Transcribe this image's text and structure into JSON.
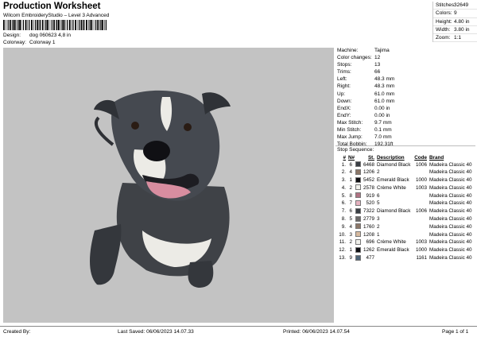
{
  "header": {
    "title": "Production Worksheet",
    "subtitle": "Wilcom EmbroideryStudio – Level 3 Advanced",
    "design_label": "Design:",
    "design_value": "dog 060623 4,8 in",
    "colorway_label": "Colorway:",
    "colorway_value": "Colorway 1"
  },
  "summary": [
    {
      "label": "Stitches:",
      "value": "32649"
    },
    {
      "label": "Colors:",
      "value": "9"
    },
    {
      "label": "Height:",
      "value": "4.80 in"
    },
    {
      "label": "Width:",
      "value": "3.80 in"
    },
    {
      "label": "Zoom:",
      "value": "1:1"
    }
  ],
  "specs": [
    {
      "label": "Machine:",
      "value": "Tajima"
    },
    {
      "label": "Color changes:",
      "value": "12"
    },
    {
      "label": "Stops:",
      "value": "13"
    },
    {
      "label": "Trims:",
      "value": "66"
    },
    {
      "label": "Left:",
      "value": "48.3 mm"
    },
    {
      "label": "Right:",
      "value": "48.3 mm"
    },
    {
      "label": "Up:",
      "value": "61.0 mm"
    },
    {
      "label": "Down:",
      "value": "61.0 mm"
    },
    {
      "label": "EndX:",
      "value": "0.00 in"
    },
    {
      "label": "EndY:",
      "value": "0.00 in"
    },
    {
      "label": "Max Stitch:",
      "value": "9.7 mm"
    },
    {
      "label": "Min Stitch:",
      "value": "0.1 mm"
    },
    {
      "label": "Max Jump:",
      "value": "7.0 mm"
    },
    {
      "label": "Total Bobbin:",
      "value": "192.31ft"
    }
  ],
  "sequence": {
    "title": "Stop Sequence:",
    "headers": {
      "num": "#",
      "n": "N#",
      "st": "St.",
      "desc": "Description",
      "code": "Code",
      "brand": "Brand"
    },
    "rows": [
      {
        "idx": "1.",
        "n": "6",
        "color": "#3a3f45",
        "st": "6468",
        "desc": "Diamond Black",
        "code": "1006",
        "brand": "Madeira Classic 40"
      },
      {
        "idx": "2.",
        "n": "4",
        "color": "#8c7768",
        "st": "1206",
        "desc": "2",
        "code": "",
        "brand": "Madeira Classic 40"
      },
      {
        "idx": "3.",
        "n": "1",
        "color": "#101014",
        "st": "5452",
        "desc": "Emerald Black",
        "code": "1000",
        "brand": "Madeira Classic 40"
      },
      {
        "idx": "4.",
        "n": "2",
        "color": "#f1f1ec",
        "st": "2578",
        "desc": "Crème White",
        "code": "1003",
        "brand": "Madeira Classic 40"
      },
      {
        "idx": "5.",
        "n": "8",
        "color": "#b07283",
        "st": "919",
        "desc": "6",
        "code": "",
        "brand": "Madeira Classic 40"
      },
      {
        "idx": "6.",
        "n": "7",
        "color": "#e6b2c0",
        "st": "520",
        "desc": "5",
        "code": "",
        "brand": "Madeira Classic 40"
      },
      {
        "idx": "7.",
        "n": "6",
        "color": "#3a3f45",
        "st": "7322",
        "desc": "Diamond Black",
        "code": "1006",
        "brand": "Madeira Classic 40"
      },
      {
        "idx": "8.",
        "n": "5",
        "color": "#6a6868",
        "st": "2779",
        "desc": "3",
        "code": "",
        "brand": "Madeira Classic 40"
      },
      {
        "idx": "9.",
        "n": "4",
        "color": "#8c7768",
        "st": "1760",
        "desc": "2",
        "code": "",
        "brand": "Madeira Classic 40"
      },
      {
        "idx": "10.",
        "n": "3",
        "color": "#d7ba9f",
        "st": "1208",
        "desc": "1",
        "code": "",
        "brand": "Madeira Classic 40"
      },
      {
        "idx": "11.",
        "n": "2",
        "color": "#f1f1ec",
        "st": "696",
        "desc": "Crème White",
        "code": "1003",
        "brand": "Madeira Classic 40"
      },
      {
        "idx": "12.",
        "n": "1",
        "color": "#101014",
        "st": "1262",
        "desc": "Emerald Black",
        "code": "1000",
        "brand": "Madeira Classic 40"
      },
      {
        "idx": "13.",
        "n": "9",
        "color": "#4f6476",
        "st": "477",
        "desc": "",
        "code": "1161",
        "brand": "Madeira Classic 40"
      }
    ]
  },
  "footer": {
    "created_by": "Created By:",
    "last_saved": "Last Saved: 06/06/2023 14.07.33",
    "printed": "Printed: 06/06/2023 14.07.54",
    "page": "Page 1 of 1"
  },
  "colors": {
    "preview_bg": "#c3c3c3",
    "fur_dark": "#3f4247",
    "fur_white": "#ecebe6",
    "tongue": "#d88da0"
  }
}
